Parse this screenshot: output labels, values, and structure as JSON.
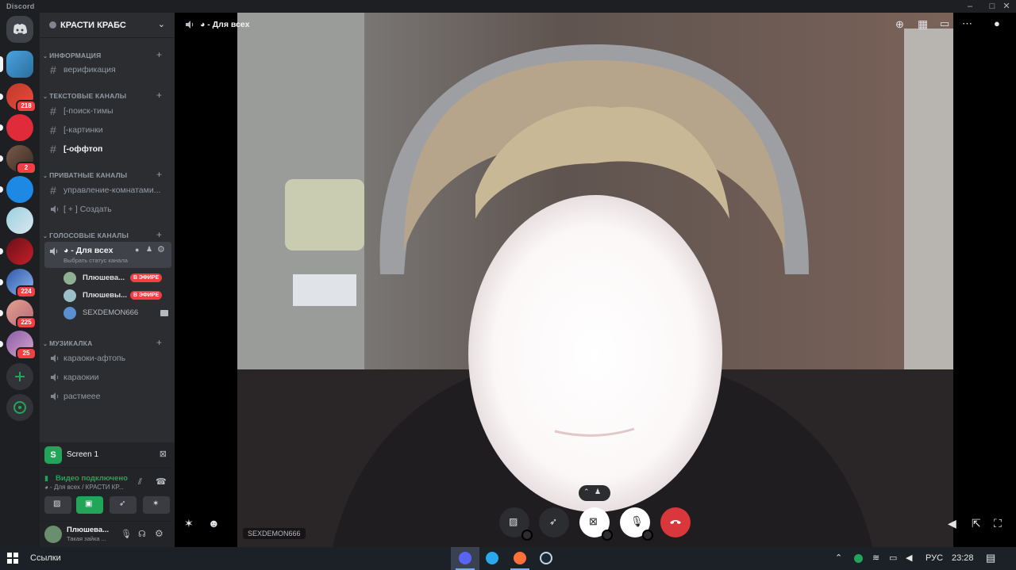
{
  "window": {
    "app_title": "Discord"
  },
  "server": {
    "name": "КРАСТИ КРАБС"
  },
  "rail_badges": [
    "218",
    "2",
    "224",
    "225",
    "25"
  ],
  "categories": {
    "info": "ИНФОРМАЦИЯ",
    "text": "ТЕКСТОВЫЕ КАНАЛЫ",
    "private": "ПРИВАТНЫЕ КАНАЛЫ",
    "voice": "ГОЛОСОВЫЕ КАНАЛЫ",
    "music": "МУЗИКАЛКА"
  },
  "channels": {
    "info": [
      "верификация"
    ],
    "text": [
      "[-поиск-тимы",
      "[-картинки",
      "[-оффтоп"
    ],
    "private": [
      "управление-комнатами...",
      "[ + ] Создать"
    ],
    "music": [
      "караоки-афтопь",
      "караокии",
      "растмеее"
    ]
  },
  "voice_channel": {
    "name": "◕ - Для всех",
    "status_hint": "Выбрать статус канала",
    "users": [
      {
        "name": "Плюшева...",
        "live": "В ЭФИРЕ"
      },
      {
        "name": "Плюшевы...",
        "live": "В ЭФИРЕ"
      },
      {
        "name": "SEXDEMON666",
        "live": ""
      }
    ]
  },
  "screen_share": {
    "label": "Screen 1",
    "avatar_letter": "S"
  },
  "voice_connection": {
    "status": "Видео подключено",
    "subtitle": "◕ - Для всех / КРАСТИ КР..."
  },
  "user_panel": {
    "name": "Плюшева...",
    "status": "Такая зайка ..."
  },
  "stage": {
    "title": "◕ - Для всех",
    "participant_tag": "SEXDEMON666"
  },
  "taskbar": {
    "search_label": "Ссылки",
    "language": "РУС",
    "time": "23:28"
  },
  "colors": {
    "accent_green": "#23a559",
    "live_red": "#f23f43",
    "end_call_red": "#da373c",
    "sidebar_bg": "#2b2d31",
    "rail_bg": "#1e1f22"
  },
  "icons": {
    "rail_home": "discord-logo-icon",
    "add_server": "plus-icon",
    "explore": "compass-icon",
    "end_call": "phone-hangup-icon"
  }
}
